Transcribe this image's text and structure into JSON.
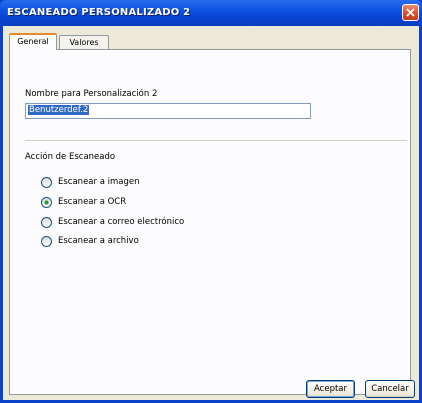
{
  "window": {
    "title": "ESCANEADO PERSONALIZADO 2"
  },
  "tabs": [
    {
      "label": "General",
      "active": true
    },
    {
      "label": "Valores",
      "active": false
    }
  ],
  "name_field": {
    "label": "Nombre para Personalización 2",
    "value": "Benutzerdef.2"
  },
  "scan_action": {
    "label": "Acción de Escaneado",
    "options": [
      {
        "label": "Escanear a imagen",
        "checked": false
      },
      {
        "label": "Escanear a OCR",
        "checked": true
      },
      {
        "label": "Escanear a correo electrónico",
        "checked": false
      },
      {
        "label": "Escanear a archivo",
        "checked": false
      }
    ]
  },
  "buttons": {
    "ok": "Aceptar",
    "cancel": "Cancelar"
  },
  "colors": {
    "titlebar": "#0b43c8",
    "dialog_bg": "#ece9d8",
    "close": "#d9512c",
    "active_tab_accent": "#e68b2c",
    "radio_selected": "#21a121"
  },
  "icons": {
    "close": "close-icon"
  }
}
